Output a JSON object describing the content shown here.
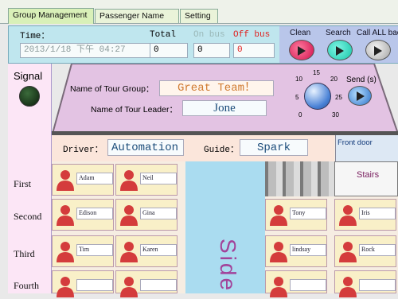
{
  "tabs": [
    {
      "label": "Group Management"
    },
    {
      "label": "Passenger Name List"
    },
    {
      "label": "Setting"
    }
  ],
  "header": {
    "time_label": "Time：",
    "time_value": "2013/1/18 下午 04:27",
    "total_label": "Total",
    "total_value": "0",
    "onbus_label": "On bus",
    "onbus_value": "0",
    "offbus_label": "Off bus",
    "offbus_value": "0",
    "clean_label": "Clean",
    "search_label": "Search",
    "callall_label": "Call ALL bac"
  },
  "signal": {
    "label": "Signal"
  },
  "tour": {
    "group_label": "Name of Tour Group：",
    "group_value": "Great Team！",
    "leader_label": "Name of Tour Leader：",
    "leader_value": "Jone",
    "send_label": "Send (s)",
    "dial_ticks": [
      "0",
      "5",
      "10",
      "15",
      "20",
      "25",
      "30"
    ]
  },
  "bus": {
    "driver_label": "Driver：",
    "driver_value": "Automation",
    "guide_label": "Guide：",
    "guide_value": "Spark",
    "frontdoor_label": "Front door",
    "stairs_label": "Stairs",
    "aisle_label": "Side",
    "rows": [
      "First",
      "Second",
      "Third",
      "Fourth"
    ],
    "seats": {
      "first_left": [
        "Adam",
        "Neil"
      ],
      "second_left": [
        "Edison",
        "Gina"
      ],
      "second_right": [
        "Tony",
        "Iris"
      ],
      "third_left": [
        "Tim",
        "Karen"
      ],
      "third_right": [
        "lindsay",
        "Rock"
      ]
    }
  },
  "colors": {
    "header_bg": "#bfe6ee",
    "roof_bg": "#e3c3e3",
    "signal_bg": "#fce6f6",
    "aisle_bg": "#aadcf0",
    "seat_bg": "#f9f0c8",
    "offbus_text": "#e0201f",
    "onbus_text": "#9ab8b8"
  }
}
